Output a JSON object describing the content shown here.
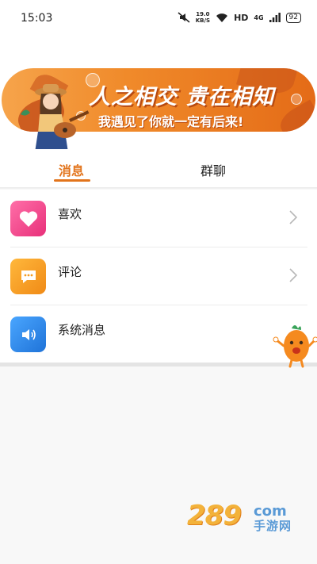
{
  "status_bar": {
    "time": "15:03",
    "net_speed_value": "19.0",
    "net_speed_unit": "KB/S",
    "hd": "HD",
    "signal_type": "4G",
    "battery": "92"
  },
  "banner": {
    "title": "人之相交 贵在相知",
    "subtitle": "我遇见了你就一定有后来!"
  },
  "tabs": [
    {
      "label": "消息",
      "active": true
    },
    {
      "label": "群聊",
      "active": false
    }
  ],
  "messages": [
    {
      "label": "喜欢",
      "icon": "heart-icon",
      "color": "#f0438a",
      "chevron": true
    },
    {
      "label": "评论",
      "icon": "comment-icon",
      "color": "#f59b20",
      "chevron": true
    },
    {
      "label": "系统消息",
      "icon": "speaker-icon",
      "color": "#2e86e8",
      "chevron": false
    }
  ],
  "watermark": {
    "number": "289",
    "domain": "com",
    "sub": "手游网"
  },
  "colors": {
    "accent": "#e2741c",
    "banner_start": "#f6a44b",
    "banner_end": "#e46b17"
  }
}
